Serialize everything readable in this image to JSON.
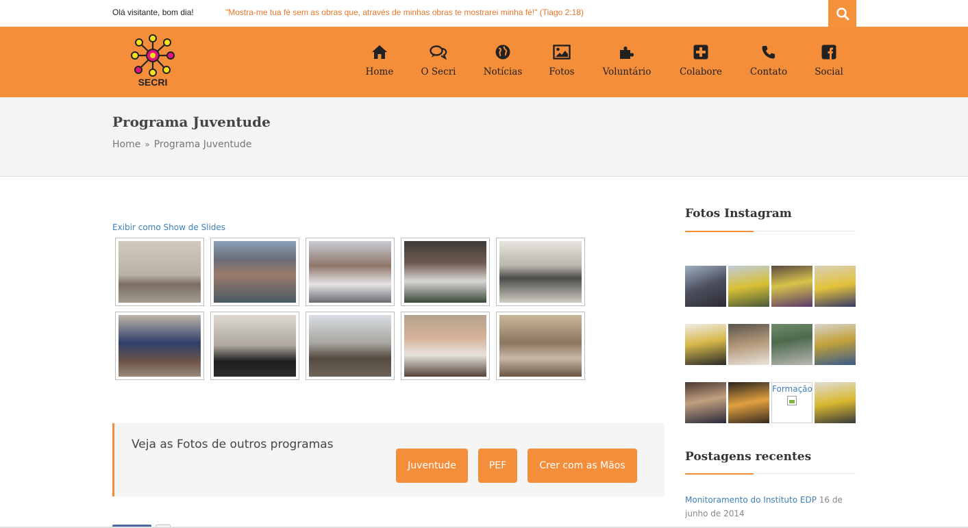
{
  "topbar": {
    "greeting": "Olá visitante, bom dia!",
    "quote": "\"Mostra-me tua fé sem as obras que, através de minhas obras te mostrarei minha fé!\" (Tiago 2:18)",
    "search_icon": "search-icon"
  },
  "logo": {
    "text": "SECRI"
  },
  "nav": [
    {
      "label": "Home",
      "icon": "home-icon"
    },
    {
      "label": "O Secri",
      "icon": "chat-bubbles-icon"
    },
    {
      "label": "Notícias",
      "icon": "globe-icon"
    },
    {
      "label": "Fotos",
      "icon": "picture-icon"
    },
    {
      "label": "Voluntário",
      "icon": "puzzle-icon"
    },
    {
      "label": "Colabore",
      "icon": "plus-square-icon"
    },
    {
      "label": "Contato",
      "icon": "phone-icon"
    },
    {
      "label": "Social",
      "icon": "facebook-icon"
    }
  ],
  "page": {
    "title": "Programa Juventude",
    "breadcrumb": {
      "home": "Home",
      "separator": "»",
      "current": "Programa Juventude"
    }
  },
  "gallery": {
    "slideshow_link": "Exibir como Show de Slides"
  },
  "cta": {
    "text": "Veja as Fotos de outros programas",
    "buttons": [
      "Juventude",
      "PEF",
      "Crer com as Mãos"
    ]
  },
  "sidebar": {
    "instagram_title": "Fotos Instagram",
    "instagram_broken_label": "Formação",
    "recent_title": "Postagens recentes",
    "recent_post_title": "Monitoramento do Instituto EDP",
    "recent_post_date": "16 de junho de 2014"
  },
  "colors": {
    "accent": "#f58e3b",
    "link": "#3d7fb8",
    "quote": "#e8762b"
  }
}
